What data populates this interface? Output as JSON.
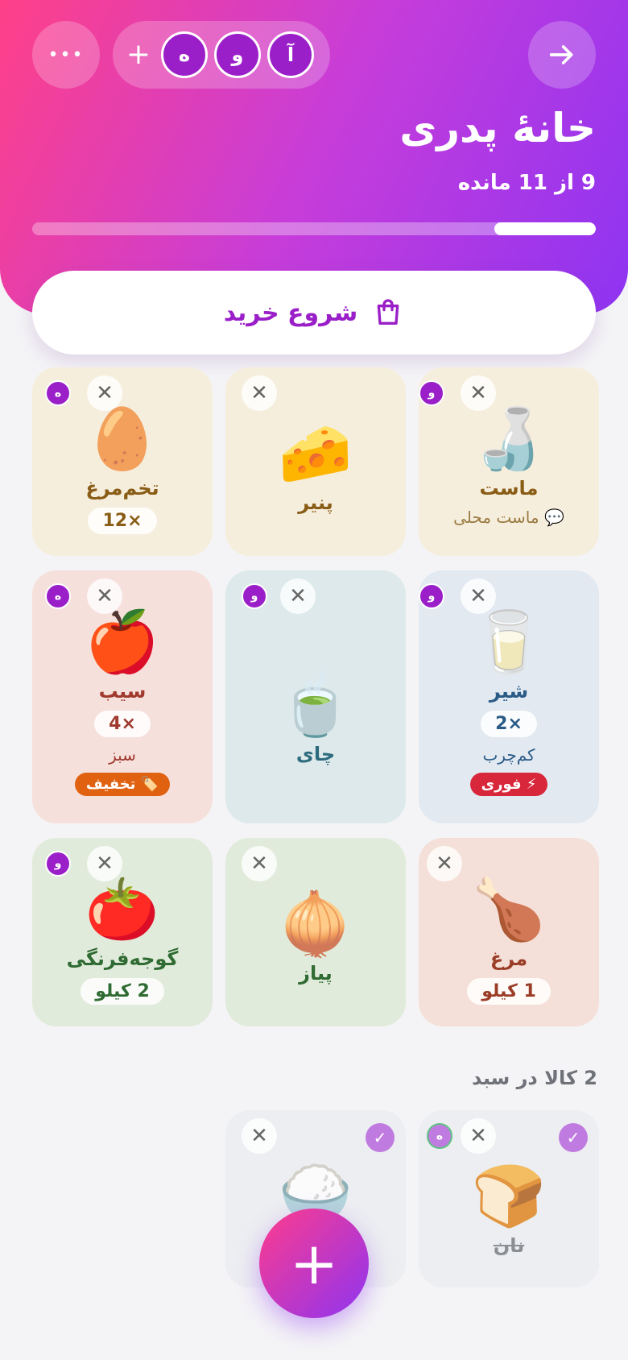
{
  "header": {
    "title": "خانهٔ پدری",
    "remaining": "9 از 11 مانده",
    "progress_fraction": 0.18,
    "members": [
      "آ",
      "و",
      "ه"
    ],
    "add_member": "+",
    "more": "•••"
  },
  "start_button": {
    "label": "شروع خرید"
  },
  "cards": [
    {
      "emoji": "🍶",
      "name": "ماست",
      "note": "💬 ماست محلی",
      "who": "و"
    },
    {
      "emoji": "🧀",
      "name": "پنیر"
    },
    {
      "emoji": "🥚",
      "name": "تخم‌مرغ",
      "qty": "×12",
      "who": "ه"
    },
    {
      "emoji": "🥛",
      "name": "شیر",
      "qty": "×2",
      "note": "کم‌چرب",
      "badge": "⚡ فوری",
      "who": "و"
    },
    {
      "emoji": "🍵",
      "name": "چای",
      "who": "و"
    },
    {
      "emoji": "🍎",
      "name": "سیب",
      "qty": "×4",
      "note": "سبز",
      "badge": "🏷️ تخفیف",
      "who": "ه"
    },
    {
      "emoji": "🍗",
      "name": "مرغ",
      "qty": "1 کیلو"
    },
    {
      "emoji": "🧅",
      "name": "پیاز"
    },
    {
      "emoji": "🍅",
      "name": "گوجه‌فرنگی",
      "qty": "2 کیلو",
      "who": "و"
    }
  ],
  "cart": {
    "title": "2 کالا در سبد",
    "items": [
      {
        "emoji": "🍞",
        "name": "نان",
        "who": "ه"
      },
      {
        "emoji": "🍚",
        "name": ""
      }
    ]
  },
  "fab": "+"
}
